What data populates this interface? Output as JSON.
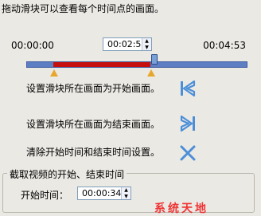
{
  "header": {
    "drag_hint": "拖动滑块可以查看每个时间点的画面。"
  },
  "timeline": {
    "start_time": "00:00:00",
    "end_time": "00:04:53",
    "current_time": "00:02:58",
    "selection_start_fraction": 0.12,
    "selection_end_fraction": 0.56,
    "thumb_fraction": 0.58
  },
  "actions": [
    {
      "label": "设置滑块所在画面为开始画面。",
      "icon": "set-start-icon"
    },
    {
      "label": "设置滑块所在画面为结束画面。",
      "icon": "set-end-icon"
    },
    {
      "label": "清除开始时间和结束时间设置。",
      "icon": "clear-x-icon"
    }
  ],
  "clip_group": {
    "title": "截取视频的开始、结束时间",
    "start_label": "开始时间：",
    "start_value": "00:00:34"
  },
  "watermark": "系统天地",
  "colors": {
    "selection": "#c61010",
    "track": "#5e7ec3",
    "icon": "#4c8fd8",
    "marker": "#e8a72c"
  }
}
